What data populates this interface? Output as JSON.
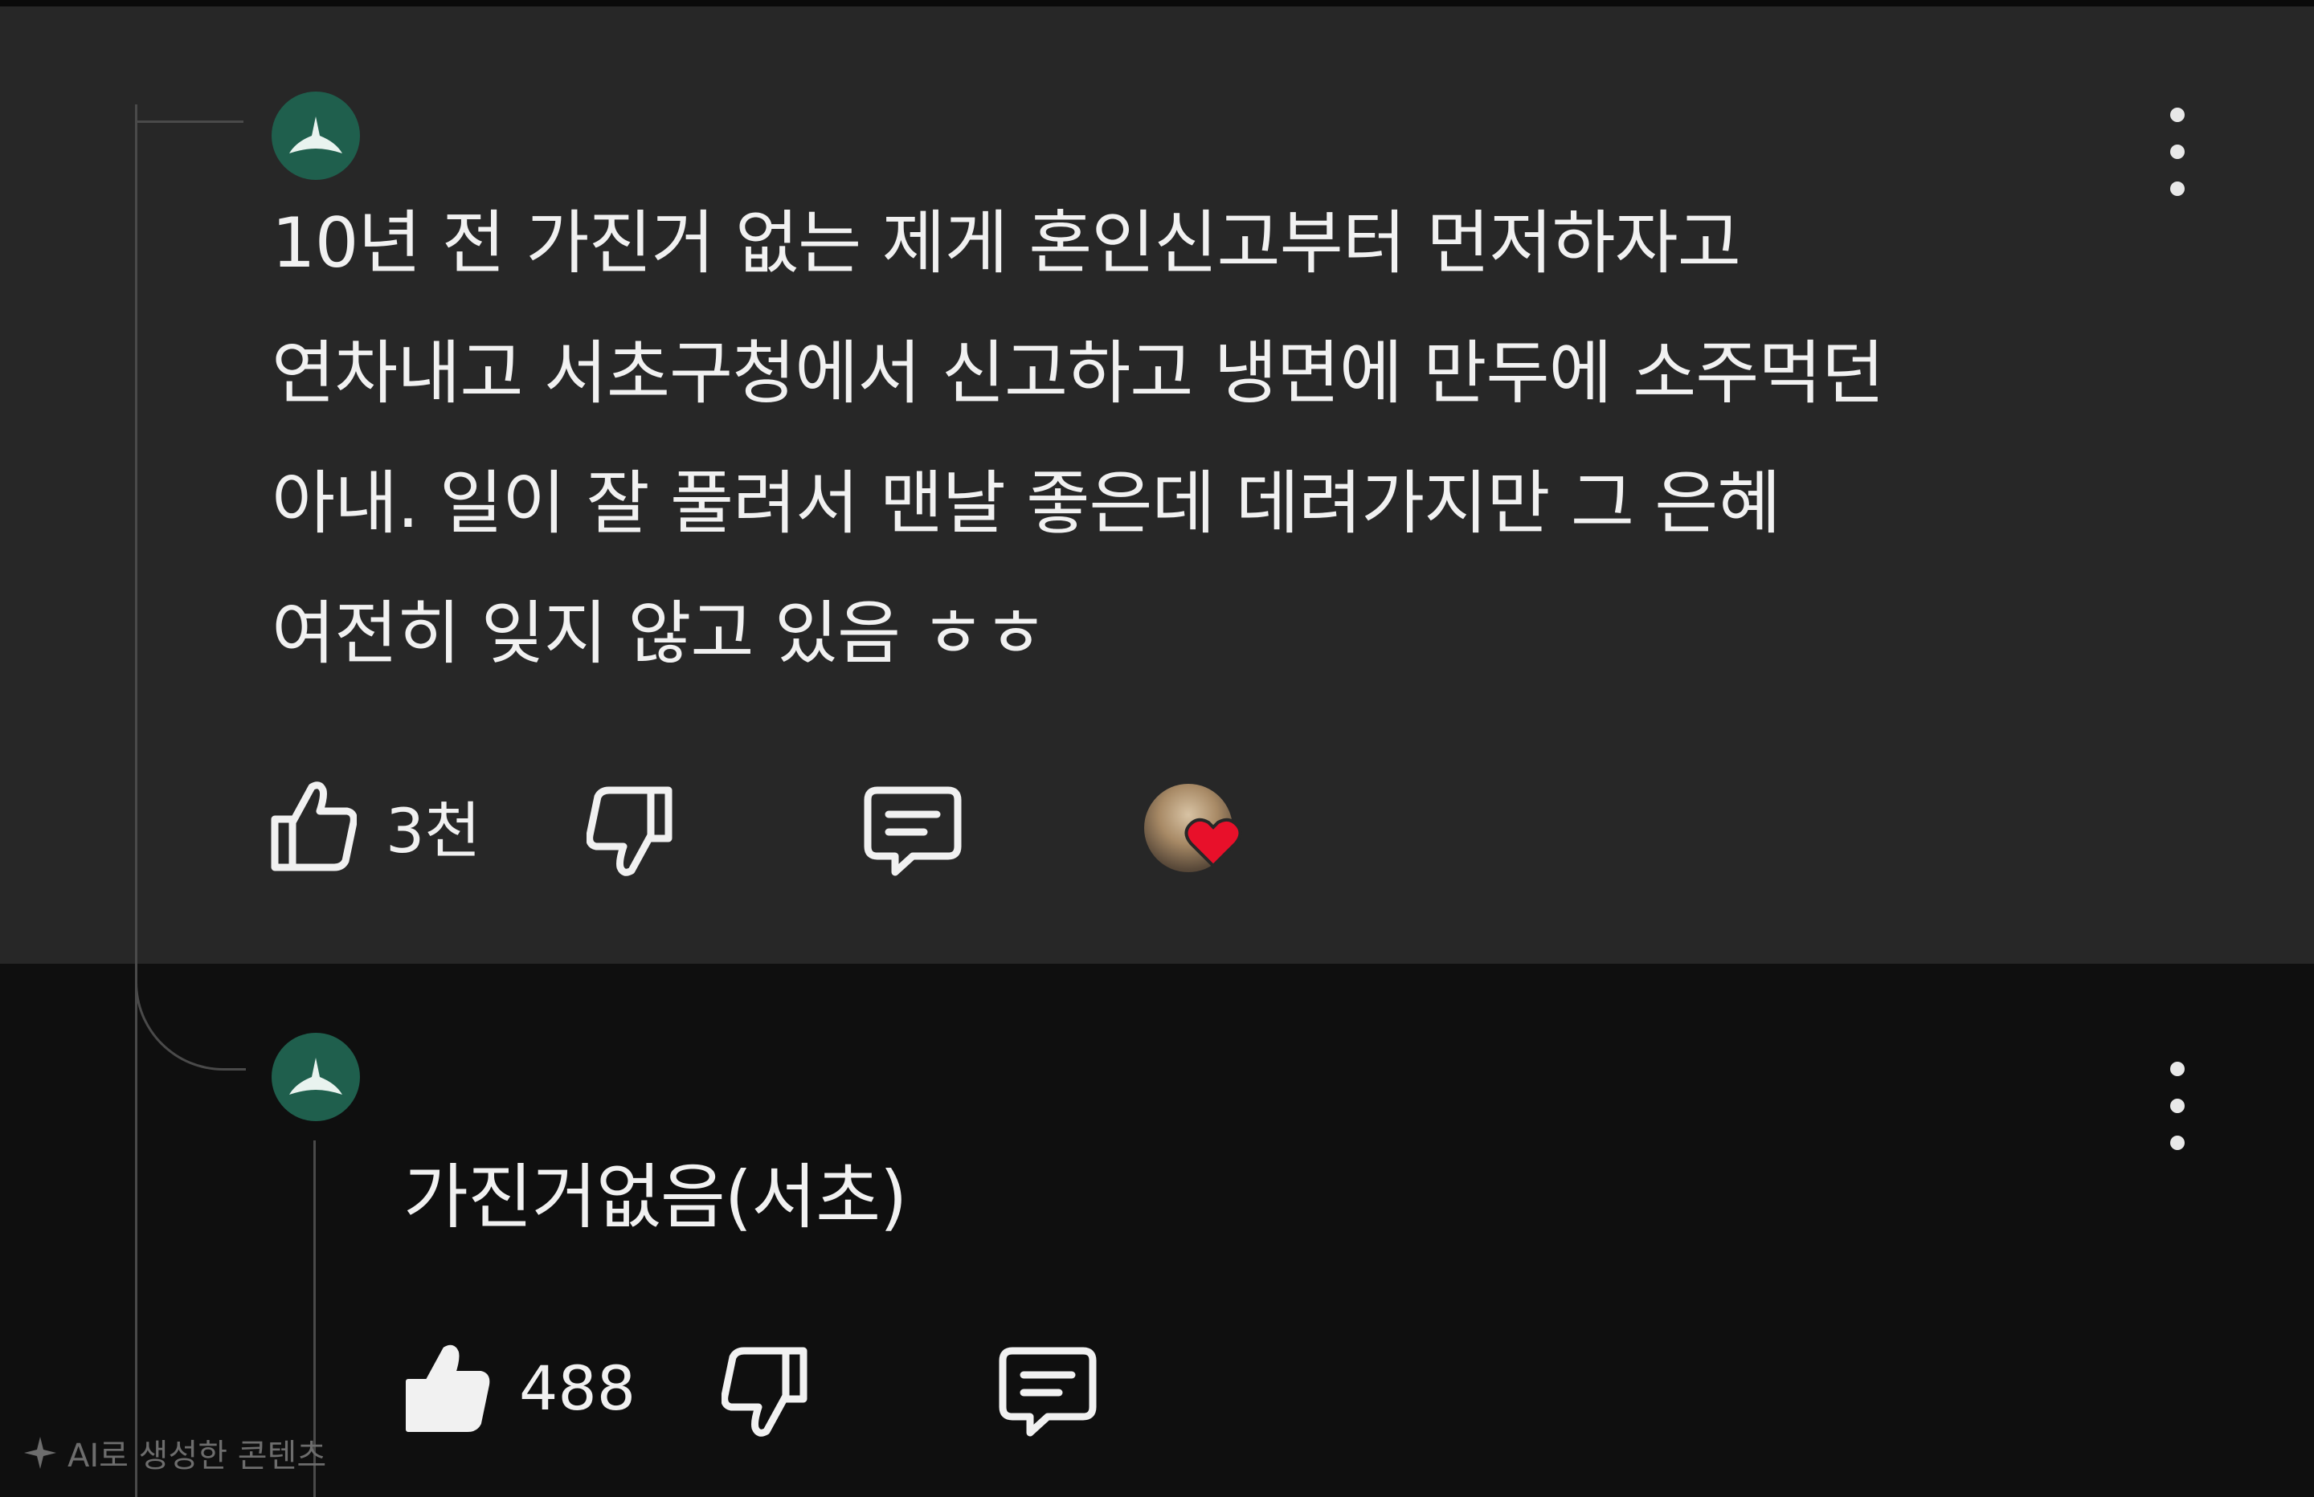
{
  "comments": [
    {
      "text": "10년 전 가진거 없는 제게 혼인신고부터 먼저하자고\n연차내고 서초구청에서 신고하고 냉면에 만두에 소주먹던\n아내. 일이 잘 풀려서 맨날 좋은데 데려가지만 그 은혜\n여전히 잊지 않고 있음 ㅎㅎ",
      "likes": "3천",
      "liked": false,
      "creator_heart": true
    },
    {
      "text": "가진거없음(서초)",
      "likes": "488",
      "liked": true,
      "creator_heart": false
    }
  ],
  "watermark": {
    "text": "AI로 생성한 콘텐츠"
  },
  "colors": {
    "highlight_bg": "#272727",
    "page_bg": "#0f0f0f",
    "avatar_bg": "#1f5f4d",
    "heart": "#e8102a",
    "text": "#f1f1f1"
  },
  "icons": {
    "avatar": "default-avatar-icon",
    "more": "more-vert-icon",
    "like": "thumb-up-icon",
    "dislike": "thumb-down-icon",
    "reply": "comment-icon",
    "heart": "heart-icon"
  }
}
